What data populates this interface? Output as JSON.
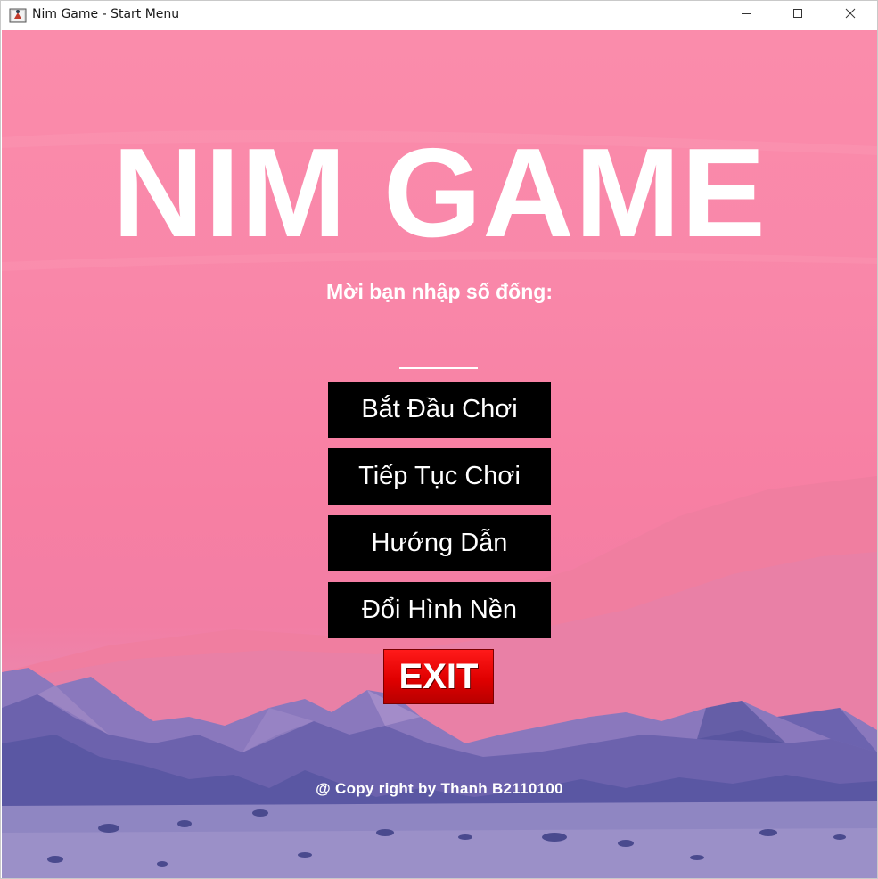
{
  "window": {
    "title": "Nim Game - Start Menu",
    "controls": {
      "minimize_icon": "minimize-icon",
      "maximize_icon": "maximize-icon",
      "close_icon": "close-icon"
    }
  },
  "main": {
    "title": "NIM GAME",
    "prompt": "Mời bạn nhập số đống:",
    "pile_input": {
      "value": "",
      "placeholder": ""
    },
    "buttons": {
      "start": "Bắt Đầu Chơi",
      "continue": "Tiếp Tục Chơi",
      "guide": "Hướng Dẫn",
      "change_background": "Đổi Hình Nền",
      "exit": "EXIT"
    },
    "copyright": "@ Copy right by Thanh B2110100"
  },
  "colors": {
    "background_pink": "#f987a9",
    "mountain_purple": "#6b63ac",
    "button_bg": "#000000",
    "exit_red": "#e00000",
    "text_white": "#ffffff"
  }
}
